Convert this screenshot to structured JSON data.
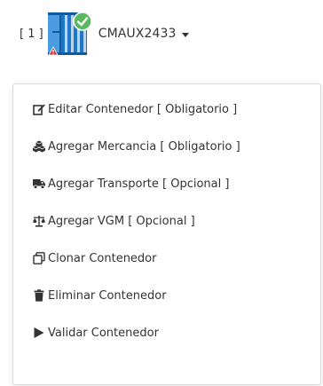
{
  "container": {
    "index_label": "[ 1 ]",
    "code": "CMAUX2433",
    "icon": "shipping-container-icon",
    "status_icon": "check-badge-icon",
    "warning_icon": "warning-icon",
    "colors": {
      "container_blue": "#1f77c9",
      "check_green": "#5cb85c",
      "warning_red": "#d9302b"
    }
  },
  "menu": {
    "items": [
      {
        "label": "Editar Contenedor [ Obligatorio ]",
        "icon": "edit-icon"
      },
      {
        "label": "Agregar Mercancia [ Obligatorio ]",
        "icon": "cubes-icon"
      },
      {
        "label": "Agregar Transporte [ Opcional ]",
        "icon": "truck-icon"
      },
      {
        "label": "Agregar VGM [ Opcional ]",
        "icon": "balance-scale-icon"
      },
      {
        "label": "Clonar Contenedor",
        "icon": "clone-icon"
      },
      {
        "label": "Eliminar Contenedor",
        "icon": "trash-icon"
      },
      {
        "label": "Validar Contenedor",
        "icon": "play-icon"
      }
    ]
  }
}
